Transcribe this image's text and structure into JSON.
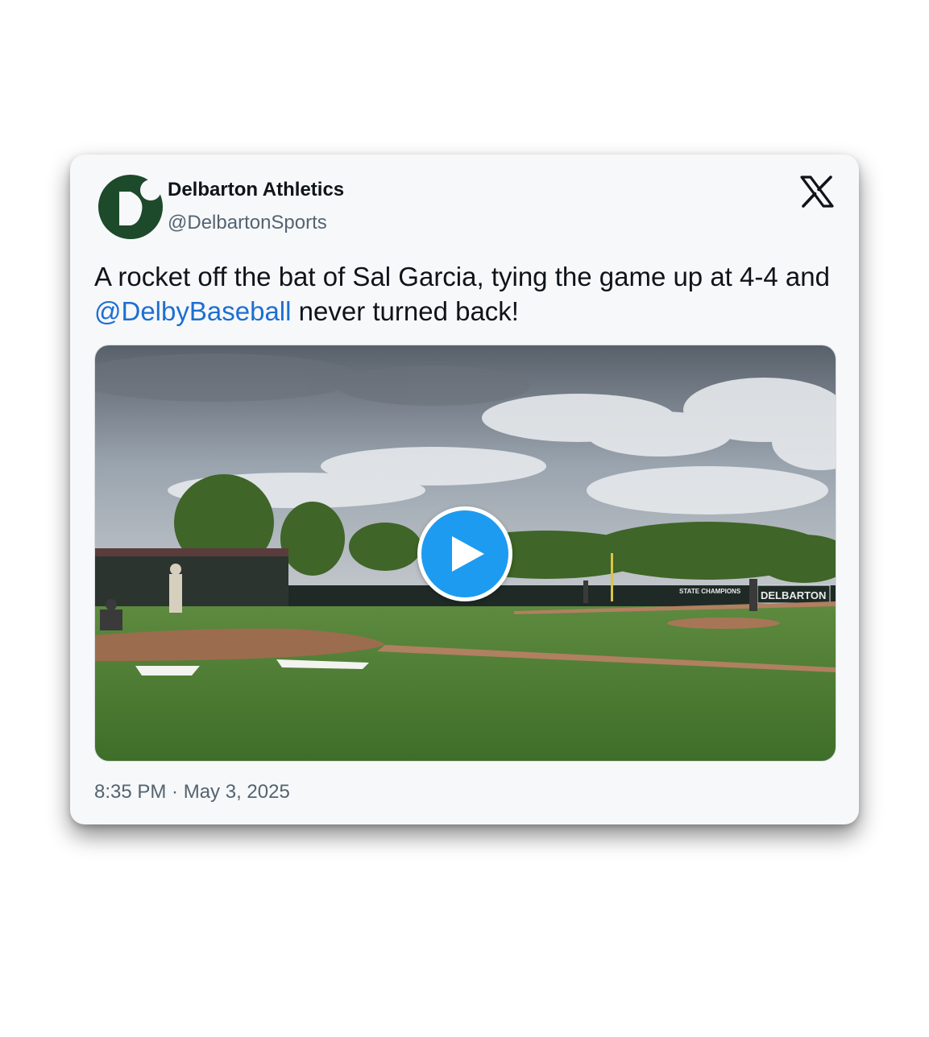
{
  "author": {
    "display_name": "Delbarton Athletics",
    "handle": "@DelbartonSports",
    "avatar_icon": "delbarton-d-logo",
    "avatar_color": "#1d4a2a"
  },
  "platform": {
    "icon": "x-logo"
  },
  "tweet": {
    "text_before": "A rocket off the bat of Sal Garcia, tying the game up at 4-4 and ",
    "mention": "@DelbyBaseball",
    "text_after": " never turned back!",
    "timestamp": "8:35 PM · May 3, 2025"
  },
  "media": {
    "type": "video",
    "play_icon": "play-icon",
    "play_color": "#1d9bf0",
    "signage": {
      "banner": "STATE CHAMPIONS",
      "wall": "DELBARTON"
    }
  },
  "colors": {
    "mention": "#1d6fd1",
    "muted": "#536471",
    "text": "#0f1419"
  }
}
